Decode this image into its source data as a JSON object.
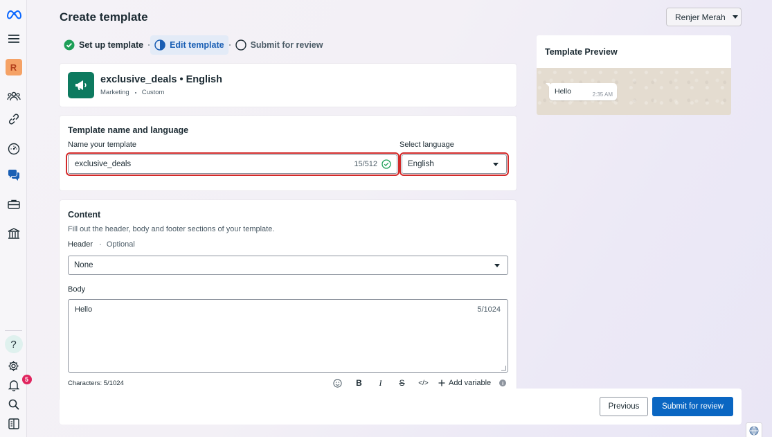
{
  "header": {
    "title": "Create template",
    "account_name": "Renjer Merah"
  },
  "sidebar": {
    "account_initial": "R",
    "help_label": "?",
    "notifications_count": "5",
    "icons": [
      "meta-logo-icon",
      "menu-icon",
      "account-avatar",
      "people-icon",
      "link-icon",
      "dashboard-icon",
      "chat-icon",
      "briefcase-icon",
      "bank-icon",
      "help-icon",
      "settings-icon",
      "bell-icon",
      "search-icon",
      "panel-icon"
    ]
  },
  "stepper": {
    "steps": [
      {
        "label": "Set up template",
        "state": "done"
      },
      {
        "label": "Edit template",
        "state": "active"
      },
      {
        "label": "Submit for review",
        "state": "pending"
      }
    ]
  },
  "template_summary": {
    "name": "exclusive_deals • English",
    "category": "Marketing",
    "type": "Custom"
  },
  "name_language": {
    "section_title": "Template name and language",
    "name_label": "Name your template",
    "name_value": "exclusive_deals",
    "name_counter": "15/512",
    "language_label": "Select language",
    "language_value": "English"
  },
  "content": {
    "section_title": "Content",
    "description": "Fill out the header, body and footer sections of your template.",
    "header_label": "Header",
    "header_optional": "Optional",
    "header_value": "None",
    "body_label": "Body",
    "body_value": "Hello",
    "body_counter": "5/1024",
    "characters": "Characters: 5/1024",
    "toolbar": {
      "bold": "B",
      "italic": "I",
      "strike": "S",
      "code": "</>",
      "add_variable": "Add variable"
    }
  },
  "footer": {
    "previous_label": "Previous",
    "submit_label": "Submit for review"
  },
  "preview": {
    "title": "Template Preview",
    "message": "Hello",
    "time": "2:35 AM"
  },
  "colors": {
    "primary": "#0a66c2",
    "template_icon_bg": "#0d7a5f",
    "success": "#1d9f57",
    "highlight_outline": "#d22a2a",
    "badge": "#e0245e"
  }
}
